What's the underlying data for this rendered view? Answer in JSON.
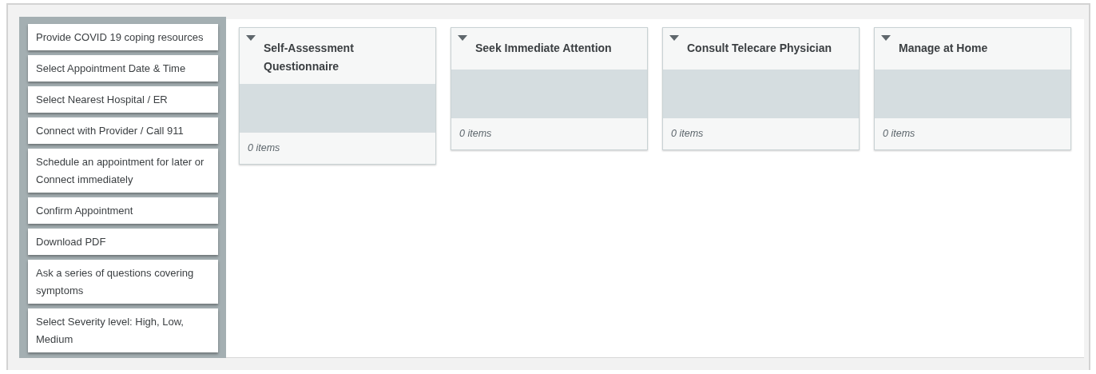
{
  "cards": [
    {
      "text": "Provide COVID 19 coping resources"
    },
    {
      "text": "Select Appointment Date & Time"
    },
    {
      "text": "Select Nearest Hospital / ER"
    },
    {
      "text": "Connect with Provider / Call 911"
    },
    {
      "text": "Schedule an appointment for later or Connect immediately"
    },
    {
      "text": "Confirm Appointment"
    },
    {
      "text": "Download PDF"
    },
    {
      "text": "Ask a series of questions covering symptoms"
    },
    {
      "text": "Select Severity level: High, Low, Medium"
    }
  ],
  "buckets": [
    {
      "title": "Self-Assessment Questionnaire",
      "count": "0 items"
    },
    {
      "title": "Seek Immediate Attention",
      "count": "0 items"
    },
    {
      "title": "Consult Telecare Physician",
      "count": "0 items"
    },
    {
      "title": "Manage at Home",
      "count": "0 items"
    }
  ]
}
